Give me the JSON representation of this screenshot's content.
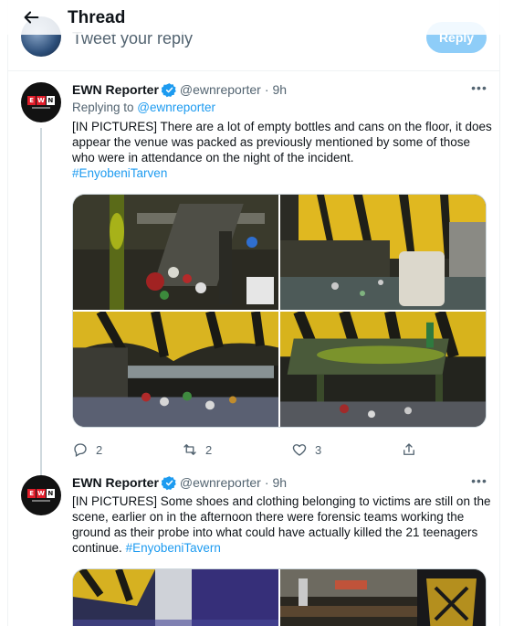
{
  "header": {
    "title": "Thread"
  },
  "composer": {
    "placeholder": "Tweet your reply",
    "reply_label": "Reply"
  },
  "tweets": [
    {
      "name": "EWN Reporter",
      "handle": "@ewnreporter",
      "sep": "·",
      "time": "9h",
      "replying_prefix": "Replying to ",
      "replying_to": "@ewnreporter",
      "text": "[IN PICTURES] There are a lot of empty bottles and cans on the floor, it does appear the venue was packed as previously mentioned by some of those who were in attendance on the night of the incident.",
      "hashtag": "#EnyobeniTarven",
      "replies": "2",
      "retweets": "2",
      "likes": "3"
    },
    {
      "name": "EWN Reporter",
      "handle": "@ewnreporter",
      "sep": "·",
      "time": "9h",
      "text": "[IN PICTURES] Some shoes and clothing belonging to victims are still on the scene, earlier on in the afternoon there were forensic teams working the ground as their probe into what could have actually killed the 21 teenagers continue.",
      "hashtag": "#EnyobeniTavern"
    }
  ],
  "logo_text": [
    "E",
    "W",
    "N"
  ],
  "colors": {
    "accent": "#1d9bf0",
    "muted": "#536471",
    "brand_red": "#e11d2a"
  },
  "icons": [
    "back-arrow-icon",
    "verified-badge-icon",
    "more-icon",
    "reply-icon",
    "retweet-icon",
    "like-icon",
    "share-icon"
  ]
}
